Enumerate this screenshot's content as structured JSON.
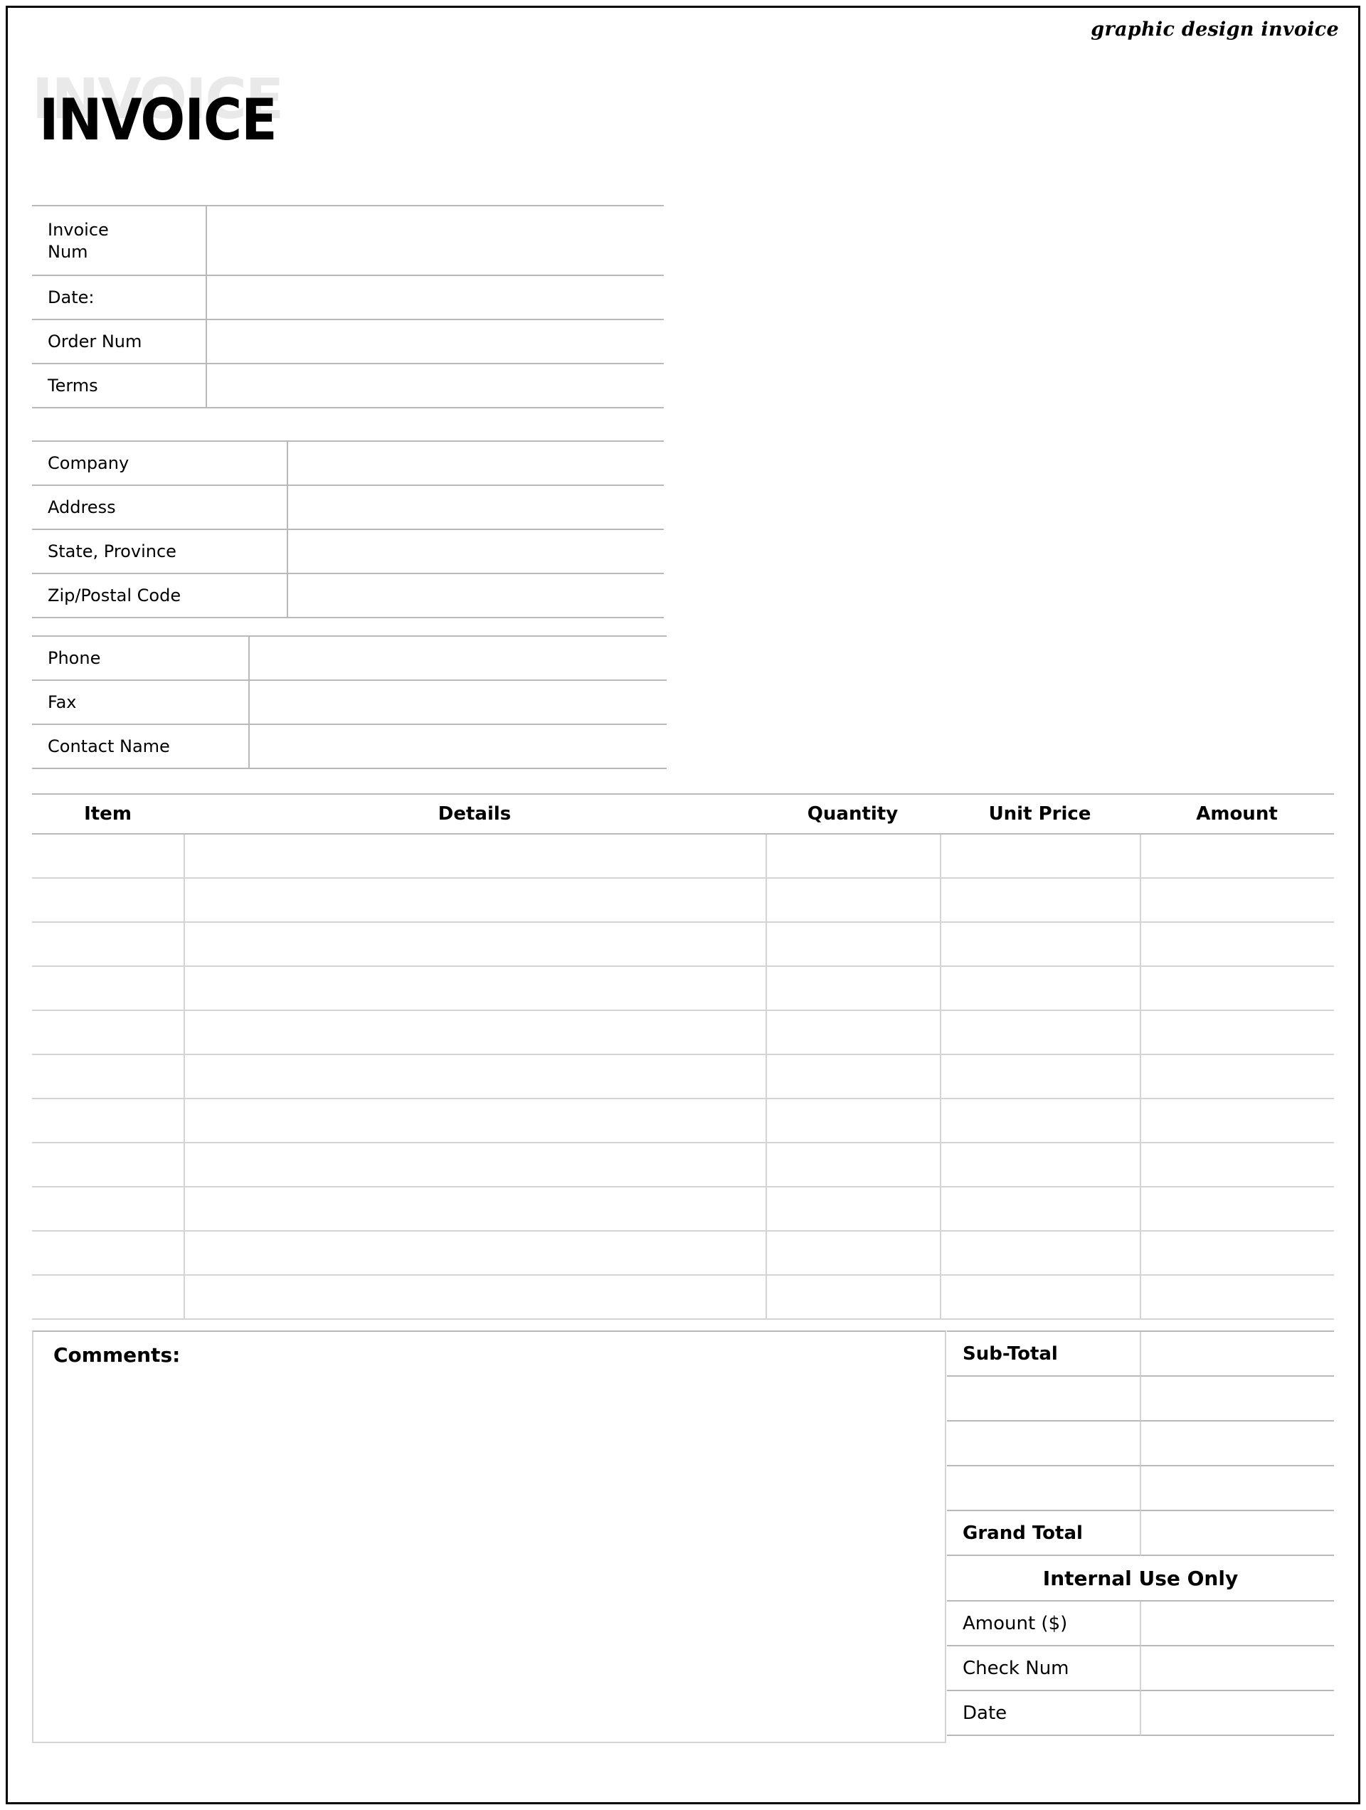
{
  "document": {
    "kicker": "graphic design invoice",
    "title": "INVOICE"
  },
  "invoice_info": {
    "rows": [
      {
        "label_line1": "Invoice",
        "label_line2": "Num",
        "value": ""
      },
      {
        "label_line1": "Date:",
        "label_line2": "",
        "value": ""
      },
      {
        "label_line1": "Order Num",
        "label_line2": "",
        "value": ""
      },
      {
        "label_line1": "Terms",
        "label_line2": "",
        "value": ""
      }
    ]
  },
  "company_info": {
    "rows": [
      {
        "label": "Company",
        "value": ""
      },
      {
        "label": "Address",
        "value": ""
      },
      {
        "label": "State, Province",
        "value": ""
      },
      {
        "label": "Zip/Postal Code",
        "value": ""
      }
    ]
  },
  "contact_info": {
    "rows": [
      {
        "label": "Phone",
        "value": ""
      },
      {
        "label": "Fax",
        "value": ""
      },
      {
        "label": "Contact Name",
        "value": ""
      }
    ]
  },
  "line_items": {
    "headers": [
      "Item",
      "Details",
      "Quantity",
      "Unit Price",
      "Amount"
    ],
    "row_count": 11,
    "rows": [
      {
        "item": "",
        "details": "",
        "quantity": "",
        "unit_price": "",
        "amount": ""
      },
      {
        "item": "",
        "details": "",
        "quantity": "",
        "unit_price": "",
        "amount": ""
      },
      {
        "item": "",
        "details": "",
        "quantity": "",
        "unit_price": "",
        "amount": ""
      },
      {
        "item": "",
        "details": "",
        "quantity": "",
        "unit_price": "",
        "amount": ""
      },
      {
        "item": "",
        "details": "",
        "quantity": "",
        "unit_price": "",
        "amount": ""
      },
      {
        "item": "",
        "details": "",
        "quantity": "",
        "unit_price": "",
        "amount": ""
      },
      {
        "item": "",
        "details": "",
        "quantity": "",
        "unit_price": "",
        "amount": ""
      },
      {
        "item": "",
        "details": "",
        "quantity": "",
        "unit_price": "",
        "amount": ""
      },
      {
        "item": "",
        "details": "",
        "quantity": "",
        "unit_price": "",
        "amount": ""
      },
      {
        "item": "",
        "details": "",
        "quantity": "",
        "unit_price": "",
        "amount": ""
      },
      {
        "item": "",
        "details": "",
        "quantity": "",
        "unit_price": "",
        "amount": ""
      }
    ]
  },
  "comments": {
    "label": "Comments:",
    "value": ""
  },
  "totals": {
    "rows": [
      {
        "label": "Sub-Total",
        "bold": true,
        "value": ""
      },
      {
        "label": "",
        "bold": false,
        "value": ""
      },
      {
        "label": "",
        "bold": false,
        "value": ""
      },
      {
        "label": "",
        "bold": false,
        "value": ""
      },
      {
        "label": "Grand Total",
        "bold": true,
        "value": ""
      }
    ],
    "internal_header": "Internal Use Only",
    "internal_rows": [
      {
        "label": "Amount ($)",
        "value": ""
      },
      {
        "label": "Check Num",
        "value": ""
      },
      {
        "label": "Date",
        "value": ""
      }
    ]
  },
  "colors": {
    "border_strong": "#b9b9b9",
    "border_light": "#d4d4d4",
    "ghost_title": "#e9e9e9",
    "text": "#000000"
  }
}
